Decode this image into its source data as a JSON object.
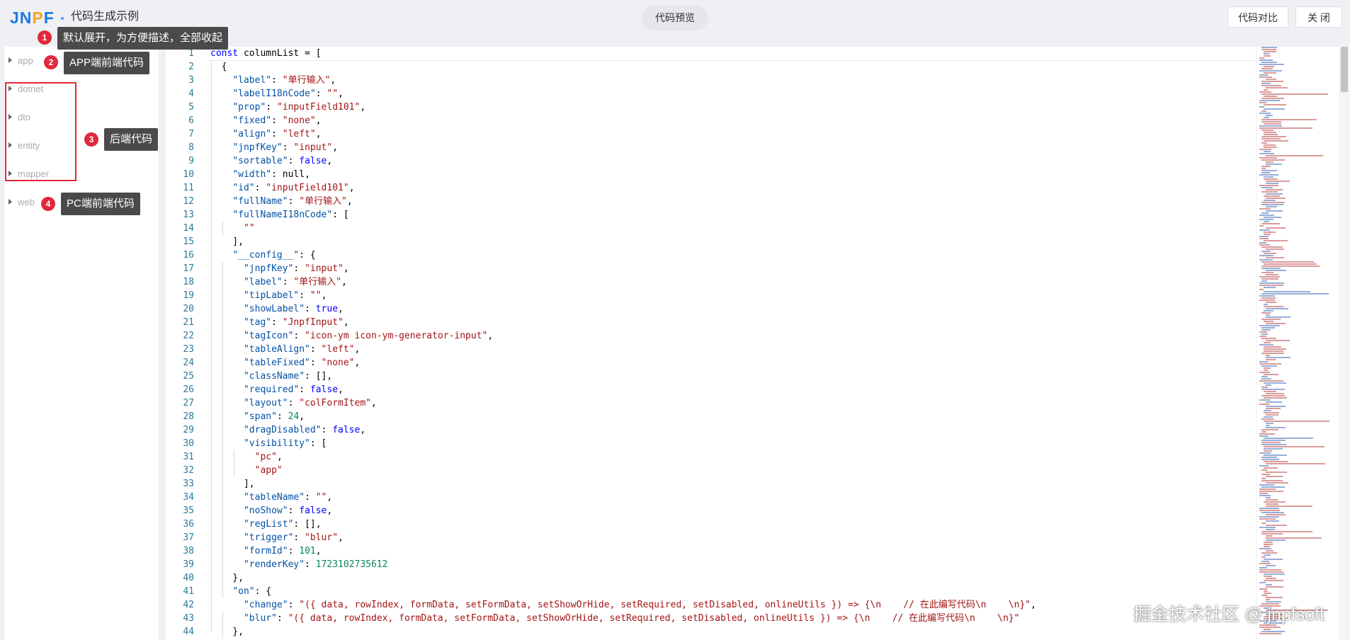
{
  "header": {
    "logo": "JNPF",
    "title": "代码生成示例",
    "tab_preview": "代码预览",
    "btn_diff": "代码对比",
    "btn_close": "关 闭"
  },
  "sidebar": {
    "items": [
      {
        "label": "app"
      },
      {
        "label": "dotnet"
      },
      {
        "label": "dto"
      },
      {
        "label": "entity"
      },
      {
        "label": "mapper"
      },
      {
        "label": "web"
      }
    ]
  },
  "annotations": [
    {
      "num": "1",
      "text": "默认展开，为方便描述，全部收起"
    },
    {
      "num": "2",
      "text": "APP端前端代码"
    },
    {
      "num": "3",
      "text": "后端代码"
    },
    {
      "num": "4",
      "text": "PC端前端代码"
    }
  ],
  "editor": {
    "lines": [
      {
        "num": "1",
        "text": "const columnList = ["
      },
      {
        "num": "2",
        "text": "  {"
      },
      {
        "num": "3",
        "text": "    \"label\": \"单行输入\","
      },
      {
        "num": "4",
        "text": "    \"labelI18nCode\": \"\","
      },
      {
        "num": "5",
        "text": "    \"prop\": \"inputField101\","
      },
      {
        "num": "6",
        "text": "    \"fixed\": \"none\","
      },
      {
        "num": "7",
        "text": "    \"align\": \"left\","
      },
      {
        "num": "8",
        "text": "    \"jnpfKey\": \"input\","
      },
      {
        "num": "9",
        "text": "    \"sortable\": false,"
      },
      {
        "num": "10",
        "text": "    \"width\": null,"
      },
      {
        "num": "11",
        "text": "    \"id\": \"inputField101\","
      },
      {
        "num": "12",
        "text": "    \"fullName\": \"单行输入\","
      },
      {
        "num": "13",
        "text": "    \"fullNameI18nCode\": ["
      },
      {
        "num": "14",
        "text": "      \"\""
      },
      {
        "num": "15",
        "text": "    ],"
      },
      {
        "num": "16",
        "text": "    \"__config__\": {"
      },
      {
        "num": "17",
        "text": "      \"jnpfKey\": \"input\","
      },
      {
        "num": "18",
        "text": "      \"label\": \"单行输入\","
      },
      {
        "num": "19",
        "text": "      \"tipLabel\": \"\","
      },
      {
        "num": "20",
        "text": "      \"showLabel\": true,"
      },
      {
        "num": "21",
        "text": "      \"tag\": \"JnpfInput\","
      },
      {
        "num": "22",
        "text": "      \"tagIcon\": \"icon-ym icon-ym-generator-input\","
      },
      {
        "num": "23",
        "text": "      \"tableAlign\": \"left\","
      },
      {
        "num": "24",
        "text": "      \"tableFixed\": \"none\","
      },
      {
        "num": "25",
        "text": "      \"className\": [],"
      },
      {
        "num": "26",
        "text": "      \"required\": false,"
      },
      {
        "num": "27",
        "text": "      \"layout\": \"colFormItem\","
      },
      {
        "num": "28",
        "text": "      \"span\": 24,"
      },
      {
        "num": "29",
        "text": "      \"dragDisabled\": false,"
      },
      {
        "num": "30",
        "text": "      \"visibility\": ["
      },
      {
        "num": "31",
        "text": "        \"pc\","
      },
      {
        "num": "32",
        "text": "        \"app\""
      },
      {
        "num": "33",
        "text": "      ],"
      },
      {
        "num": "34",
        "text": "      \"tableName\": \"\","
      },
      {
        "num": "35",
        "text": "      \"noShow\": false,"
      },
      {
        "num": "36",
        "text": "      \"regList\": [],"
      },
      {
        "num": "37",
        "text": "      \"trigger\": \"blur\","
      },
      {
        "num": "38",
        "text": "      \"formId\": 101,"
      },
      {
        "num": "39",
        "text": "      \"renderKey\": 1723102735612"
      },
      {
        "num": "40",
        "text": "    },"
      },
      {
        "num": "41",
        "text": "    \"on\": {"
      },
      {
        "num": "42",
        "text": "      \"change\": \"({ data, rowIndex, formData, setFormData, setShowOrHide, setRequired, setDisabled, onlineUtils }) => {\\n    // 在此编写代码\\n    \\n}\","
      },
      {
        "num": "43",
        "text": "      \"blur\": \"({ data, rowIndex, formData, setFormData, setShowOrHide, setRequired, setDisabled, onlineUtils }) => {\\n    // 在此编写代码\\n    \\n}\""
      },
      {
        "num": "44",
        "text": "    },"
      }
    ]
  },
  "watermark": "掘金技术社区 @ jnpfsoft"
}
